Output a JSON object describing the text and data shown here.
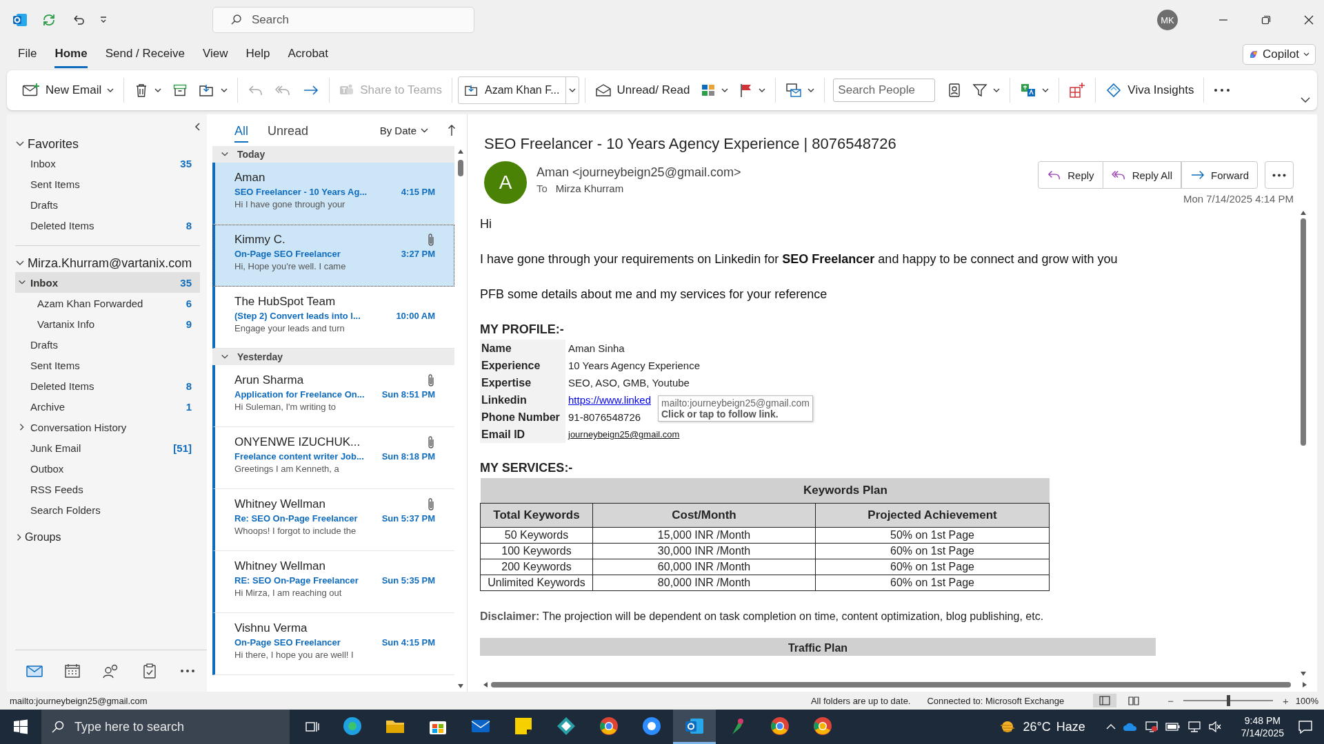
{
  "title_bar": {
    "search": {
      "placeholder": "Search"
    },
    "avatar": "MK"
  },
  "menu_tabs": [
    {
      "label": "File",
      "selected": false
    },
    {
      "label": "Home",
      "selected": true
    },
    {
      "label": "Send / Receive",
      "selected": false
    },
    {
      "label": "View",
      "selected": false
    },
    {
      "label": "Help",
      "selected": false
    },
    {
      "label": "Acrobat",
      "selected": false
    }
  ],
  "copilot": "Copilot",
  "ribbon": {
    "new_email": "New Email",
    "reply": {
      "disabled": true
    },
    "reply_all": {
      "disabled": true
    },
    "forward": {
      "disabled": false
    },
    "share_to_teams": {
      "label": "Share to Teams",
      "disabled": true
    },
    "quick_step": "Azam Khan F...",
    "unread_read": "Unread/ Read",
    "search_people": {
      "placeholder": "Search People"
    },
    "viva_insights": "Viva Insights"
  },
  "folder_pane": {
    "favorites": {
      "label": "Favorites",
      "expanded": true,
      "items": [
        {
          "label": "Inbox",
          "count": "35",
          "selected": false
        },
        {
          "label": "Sent Items",
          "selected": false
        },
        {
          "label": "Drafts",
          "selected": false
        },
        {
          "label": "Deleted Items",
          "count": "8",
          "selected": false
        }
      ]
    },
    "account": {
      "label": "Mirza.Khurram@vartanix.com",
      "expanded": true,
      "folders": [
        {
          "label": "Inbox",
          "count": "35",
          "selected": true,
          "expanded": true,
          "children": [
            {
              "label": "Azam Khan Forwarded",
              "count": "6",
              "selected": false
            },
            {
              "label": "Vartanix Info",
              "count": "9",
              "selected": false
            }
          ]
        },
        {
          "label": "Drafts",
          "selected": false
        },
        {
          "label": "Sent Items",
          "selected": false
        },
        {
          "label": "Deleted Items",
          "count": "8",
          "selected": false
        },
        {
          "label": "Archive",
          "count": "1",
          "selected": false
        },
        {
          "label": "Conversation History",
          "selected": false,
          "expanded": false
        },
        {
          "label": "Junk Email",
          "count": "[51]",
          "selected": false
        },
        {
          "label": "Outbox",
          "selected": false
        },
        {
          "label": "RSS Feeds",
          "selected": false
        },
        {
          "label": "Search Folders",
          "selected": false
        }
      ]
    },
    "groups": {
      "label": "Groups",
      "expanded": false
    },
    "nav": [
      {
        "selected": true
      },
      {
        "selected": false
      },
      {
        "selected": false
      },
      {
        "selected": false
      },
      {
        "selected": false
      }
    ]
  },
  "message_list": {
    "filters": [
      {
        "label": "All",
        "selected": true
      },
      {
        "label": "Unread",
        "selected": false
      }
    ],
    "sort": "By Date",
    "groups": [
      {
        "label": "Today",
        "expanded": true,
        "messages": [
          {
            "sender": "Aman",
            "subject": "SEO Freelancer - 10 Years Ag...",
            "time": "4:15 PM",
            "preview": "Hi   I have gone through your",
            "attachment": false,
            "selected": true,
            "focused": false,
            "unread": true
          },
          {
            "sender": "Kimmy C.",
            "subject": "On-Page SEO Freelancer",
            "time": "3:27 PM",
            "preview": "Hi,  Hope you're well. I came",
            "attachment": true,
            "selected": true,
            "focused": true,
            "unread": true
          },
          {
            "sender": "The HubSpot Team",
            "subject": "(Step 2) Convert leads into l...",
            "time": "10:00 AM",
            "preview": "Engage your leads and turn",
            "attachment": false,
            "selected": false,
            "focused": false,
            "unread": true
          }
        ]
      },
      {
        "label": "Yesterday",
        "expanded": true,
        "messages": [
          {
            "sender": "Arun Sharma",
            "subject": "Application for Freelance On...",
            "time": "Sun 8:51 PM",
            "preview": "Hi Suleman,  I'm writing to",
            "attachment": true,
            "selected": false,
            "focused": false,
            "unread": true
          },
          {
            "sender": "ONYENWE IZUCHUK...",
            "subject": "Freelance content writer Job...",
            "time": "Sun 8:18 PM",
            "preview": "Greetings   I am Kenneth, a",
            "attachment": true,
            "selected": false,
            "focused": false,
            "unread": true
          },
          {
            "sender": "Whitney Wellman",
            "subject": "Re: SEO On-Page Freelancer",
            "time": "Sun 5:37 PM",
            "preview": "Whoops! I forgot to include the",
            "attachment": true,
            "selected": false,
            "focused": false,
            "unread": true
          },
          {
            "sender": "Whitney Wellman",
            "subject": "RE: SEO On-Page Freelancer",
            "time": "Sun 5:35 PM",
            "preview": "Hi Mirza,  I am reaching out",
            "attachment": false,
            "selected": false,
            "focused": false,
            "unread": true
          },
          {
            "sender": "Vishnu Verma",
            "subject": "On-Page SEO Freelancer",
            "time": "Sun 4:15 PM",
            "preview": "Hi there,  I hope you are well!  I",
            "attachment": false,
            "selected": false,
            "focused": false,
            "unread": true
          }
        ]
      }
    ]
  },
  "reading_pane": {
    "subject": "SEO Freelancer - 10 Years Agency Experience | 8076548726",
    "avatar": "A",
    "from": "Aman <journeybeign25@gmail.com>",
    "to_label": "To",
    "to": "Mirza Khurram",
    "actions": [
      "Reply",
      "Reply All",
      "Forward"
    ],
    "date": "Mon 7/14/2025 4:14 PM",
    "body": {
      "greeting": "Hi",
      "paragraphs": [
        "I have gone through your requirements on Linkedin for **SEO Freelancer** and happy to be connect and grow with you",
        "PFB some details about me and my services for your reference"
      ],
      "profile_heading": "MY PROFILE:-",
      "profile": [
        {
          "label": "Name",
          "value": "Aman Sinha",
          "kind": "text"
        },
        {
          "label": "Experience",
          "value": "10 Years Agency Experience",
          "kind": "text"
        },
        {
          "label": "Expertise",
          "value": "SEO, ASO, GMB, Youtube",
          "kind": "text"
        },
        {
          "label": "Linkedin",
          "value": "https://www.linked",
          "kind": "link"
        },
        {
          "label": "Phone Number",
          "value": "91-8076548726",
          "kind": "text"
        },
        {
          "label": "Email ID",
          "value": "journeybeign25@gmail.com",
          "kind": "email"
        }
      ],
      "tooltip": {
        "url": "mailto:journeybeign25@gmail.com",
        "hint": "Click or tap to follow link."
      },
      "services_heading": "MY SERVICES:-",
      "keywords_table": {
        "title": "Keywords Plan",
        "columns": [
          "Total Keywords",
          "Cost/Month",
          "Projected Achievement"
        ],
        "rows": [
          [
            "50 Keywords",
            "15,000 INR /Month",
            "50% on 1st Page"
          ],
          [
            "100 Keywords",
            "30,000 INR /Month",
            "60% on 1st Page"
          ],
          [
            "200 Keywords",
            "60,000 INR /Month",
            "60% on 1st Page"
          ],
          [
            "Unlimited Keywords",
            "80,000 INR /Month",
            "60% on 1st Page"
          ]
        ]
      },
      "disclaimer": "**Disclaimer:** The projection will be dependent on task completion on time, content optimization, blog publishing, etc.",
      "traffic_table_title": "Traffic Plan"
    }
  },
  "status_bar": {
    "link": "mailto:journeybeign25@gmail.com",
    "sync": "All folders are up to date.",
    "connection": "Connected to: Microsoft Exchange",
    "zoom": {
      "minus": "−",
      "plus": "+",
      "level": 0.5,
      "percent": "100%"
    }
  },
  "taskbar": {
    "search": {
      "placeholder": "Type here to search"
    },
    "apps": [
      {
        "active": false
      },
      {
        "active": false
      },
      {
        "active": false
      },
      {
        "active": false
      },
      {
        "active": false
      },
      {
        "active": false
      },
      {
        "active": false
      },
      {
        "active": false
      },
      {
        "active": true
      },
      {
        "active": false
      },
      {
        "active": false
      },
      {
        "active": false
      }
    ],
    "temperature": "26°C",
    "weather": "Haze",
    "time": "9:48 PM",
    "date": "7/14/2025"
  }
}
